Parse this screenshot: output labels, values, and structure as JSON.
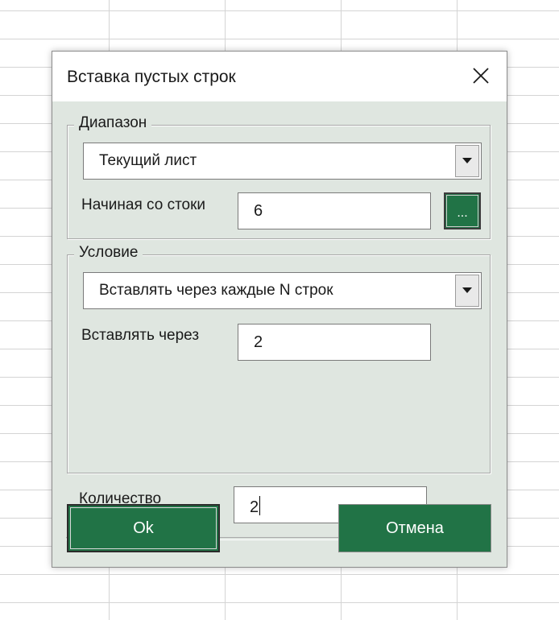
{
  "dialog": {
    "title": "Вставка пустых строк"
  },
  "range_group": {
    "legend": "Диапазон",
    "combo_value": "Текущий лист",
    "start_label": "Начиная со стоки",
    "start_value": "6",
    "browse_label": "..."
  },
  "condition_group": {
    "legend": "Условие",
    "combo_value": "Вставлять через каждые N строк",
    "every_label": "Вставлять через",
    "every_value": "2"
  },
  "quantity": {
    "label": "Количество",
    "value": "2"
  },
  "buttons": {
    "ok_label": "Ok",
    "cancel_label": "Отмена"
  },
  "colors": {
    "accent": "#217346",
    "client_bg": "#dfe6e0"
  },
  "icons": {
    "close": "close-icon",
    "dropdown": "chevron-down-icon"
  }
}
